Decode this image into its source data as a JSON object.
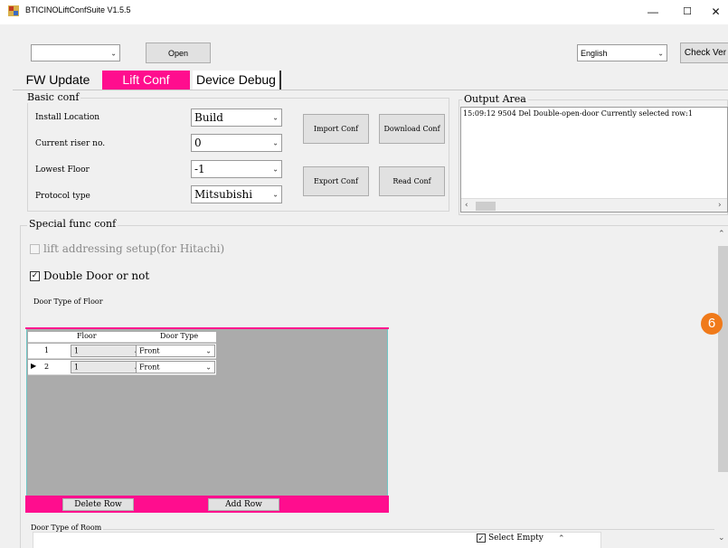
{
  "window": {
    "title": "BTICINOLiftConfSuite V1.5.5",
    "minimize": "—",
    "maximize": "☐",
    "close": "✕"
  },
  "toolbar": {
    "port_value": "",
    "open_label": "Open",
    "language_value": "English",
    "check_ver_label": "Check Ver"
  },
  "tabs": [
    {
      "label": "FW Update"
    },
    {
      "label": "Lift Conf"
    },
    {
      "label": "Device Debug"
    }
  ],
  "basic_conf": {
    "title": "Basic conf",
    "fields": [
      {
        "label": "Install Location",
        "value": "Build"
      },
      {
        "label": "Current riser no.",
        "value": "0"
      },
      {
        "label": "Lowest Floor",
        "value": "-1"
      },
      {
        "label": "Protocol type",
        "value": "Mitsubishi"
      }
    ],
    "import_label": "Import Conf",
    "download_label": "Download Conf",
    "export_label": "Export Conf",
    "read_label": "Read Conf"
  },
  "output": {
    "title": "Output Area",
    "log": "15:09:12 9504  Del Double-open-door Currently selected row:1"
  },
  "special": {
    "title": "Special func conf",
    "lift_addressing_label": "lift addressing setup(for Hitachi)",
    "lift_addressing_checked": false,
    "double_door_label": "Double Door or not",
    "double_door_checked": true,
    "door_type_floor_label": "Door Type of Floor",
    "grid": {
      "headers": [
        "Floor",
        "Door Type"
      ],
      "rows": [
        {
          "index": "1",
          "floor": "1",
          "door_type": "Front",
          "current": false
        },
        {
          "index": "2",
          "floor": "1",
          "door_type": "Front",
          "current": true
        }
      ]
    },
    "delete_row_label": "Delete Row",
    "add_row_label": "Add Row",
    "door_type_room_label": "Door Type of Room",
    "select_empty_label": "Select Empty",
    "select_empty_checked": true
  },
  "callout": {
    "number": "6",
    "color": "#f07a1a"
  },
  "colors": {
    "accent": "#ff0d8e",
    "grid_bg": "#ababab"
  }
}
